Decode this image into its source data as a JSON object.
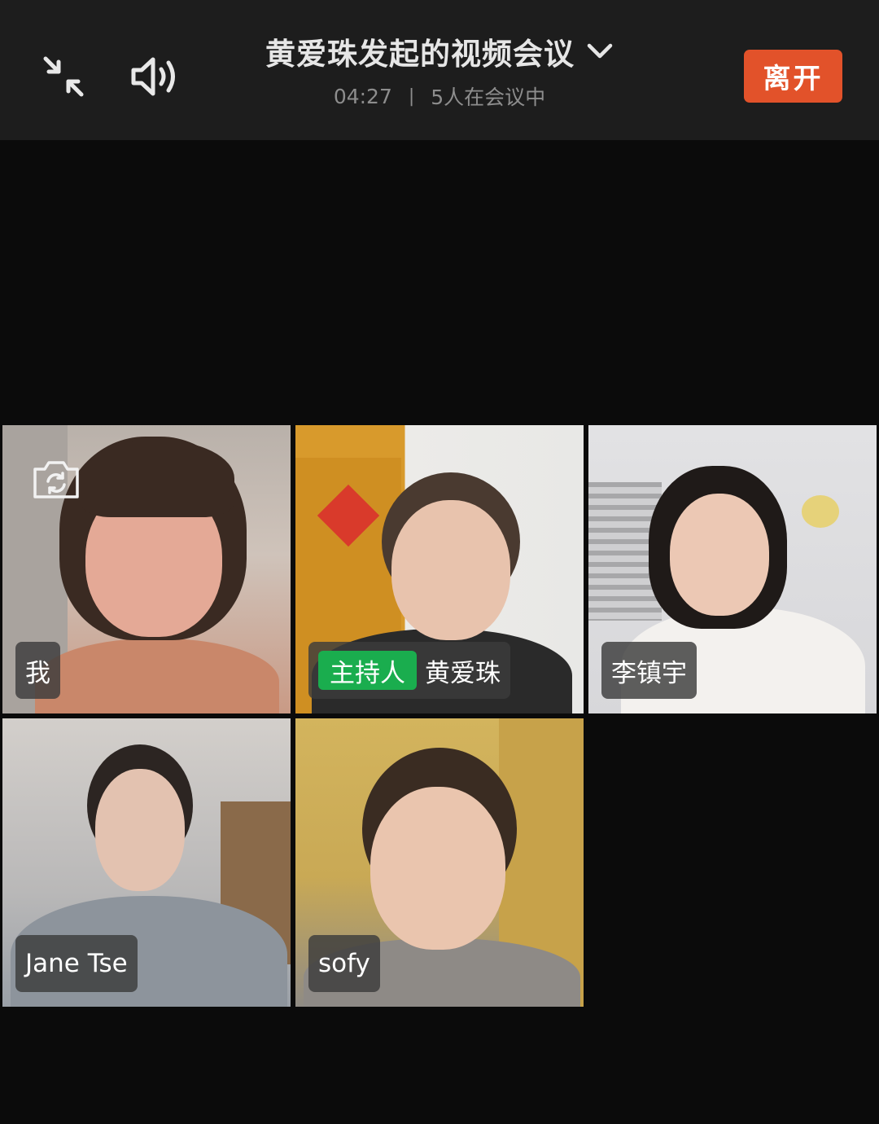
{
  "header": {
    "title": "黄爱珠发起的视频会议",
    "duration": "04:27",
    "separator": "|",
    "participant_status": "5人在会议中",
    "leave_label": "离开",
    "icons": {
      "minimize": "minimize-arrows-icon",
      "speaker": "speaker-on-icon",
      "dropdown": "chevron-down-icon"
    }
  },
  "participants": [
    {
      "name": "我",
      "is_host": false,
      "is_self": true
    },
    {
      "name": "黄爱珠",
      "is_host": true,
      "host_label": "主持人"
    },
    {
      "name": "李镇宇",
      "is_host": false
    },
    {
      "name": "Jane Tse",
      "is_host": false
    },
    {
      "name": "sofy",
      "is_host": false
    }
  ],
  "colors": {
    "header_bg": "#1d1d1d",
    "page_bg": "#0b0b0b",
    "leave_button": "#e2522a",
    "host_badge": "#1aad4e"
  }
}
